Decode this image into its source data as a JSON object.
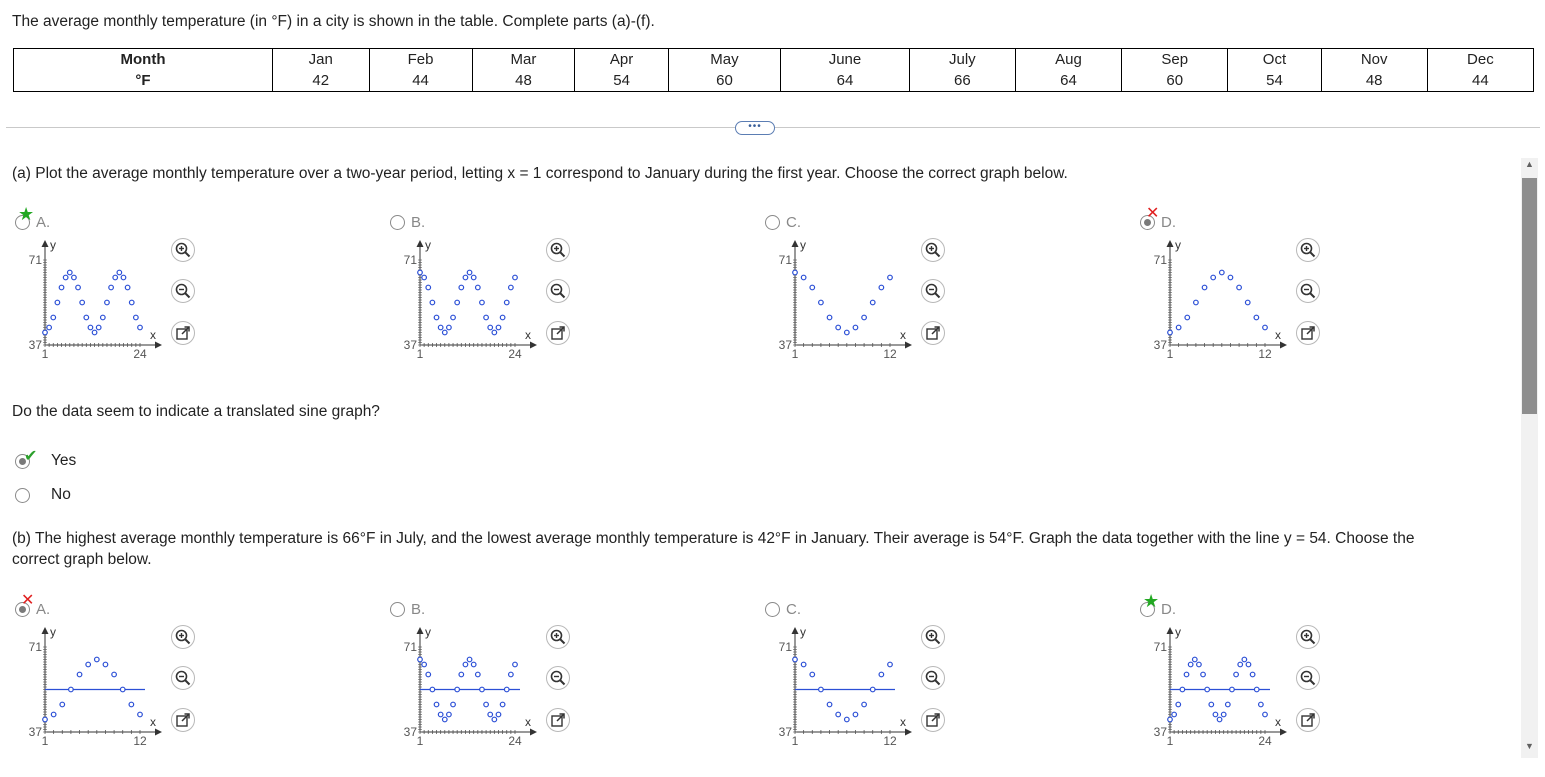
{
  "prompt": "The average monthly temperature (in °F) in a city is shown in the table. Complete parts (a)-(f).",
  "table": {
    "header_label": "Month",
    "value_label": "°F",
    "months": [
      "Jan",
      "Feb",
      "Mar",
      "Apr",
      "May",
      "June",
      "July",
      "Aug",
      "Sep",
      "Oct",
      "Nov",
      "Dec"
    ],
    "temps": [
      "42",
      "44",
      "48",
      "54",
      "60",
      "64",
      "66",
      "64",
      "60",
      "54",
      "48",
      "44"
    ]
  },
  "expander_label": "•••",
  "part_a": {
    "question": "(a) Plot the average monthly temperature over a two-year period, letting x = 1 correspond to January during the first year. Choose the correct graph below.",
    "sub_question": "Do the data seem to indicate a translated sine graph?",
    "yes_label": "Yes",
    "no_label": "No",
    "selected": "Yes",
    "options": [
      {
        "letter": "A.",
        "status": "correct",
        "selected": false
      },
      {
        "letter": "B.",
        "status": "none",
        "selected": false
      },
      {
        "letter": "C.",
        "status": "none",
        "selected": false
      },
      {
        "letter": "D.",
        "status": "incorrect",
        "selected": true
      }
    ]
  },
  "part_b": {
    "question_line1": "(b) The highest average monthly temperature is 66°F in July, and the lowest average monthly temperature is 42°F in January. Their average is 54°F. Graph the data together with the line y = 54. Choose the",
    "question_line2": "correct graph below.",
    "options": [
      {
        "letter": "A.",
        "status": "incorrect",
        "selected": true
      },
      {
        "letter": "B.",
        "status": "none",
        "selected": false
      },
      {
        "letter": "C.",
        "status": "none",
        "selected": false
      },
      {
        "letter": "D.",
        "status": "correct",
        "selected": false
      }
    ]
  },
  "graph_labels": {
    "y_axis": "y",
    "x_axis": "x",
    "y_top": "71",
    "y_bottom": "37",
    "x_start": "1",
    "x_end_12": "12",
    "x_end_24": "24"
  },
  "chart_data": [
    {
      "type": "scatter",
      "id": "a-A",
      "x": [
        1,
        2,
        3,
        4,
        5,
        6,
        7,
        8,
        9,
        10,
        11,
        12,
        13,
        14,
        15,
        16,
        17,
        18,
        19,
        20,
        21,
        22,
        23,
        24
      ],
      "y": [
        42,
        44,
        48,
        54,
        60,
        64,
        66,
        64,
        60,
        54,
        48,
        44,
        42,
        44,
        48,
        54,
        60,
        64,
        66,
        64,
        60,
        54,
        48,
        44
      ],
      "xlim": [
        1,
        24
      ],
      "ylim": [
        37,
        71
      ],
      "hline": null
    },
    {
      "type": "scatter",
      "id": "a-B",
      "x": [
        1,
        2,
        3,
        4,
        5,
        6,
        7,
        8,
        9,
        10,
        11,
        12,
        13,
        14,
        15,
        16,
        17,
        18,
        19,
        20,
        21,
        22,
        23,
        24
      ],
      "y": [
        66,
        64,
        60,
        54,
        48,
        44,
        42,
        44,
        48,
        54,
        60,
        64,
        66,
        64,
        60,
        54,
        48,
        44,
        42,
        44,
        48,
        54,
        60,
        64
      ],
      "xlim": [
        1,
        24
      ],
      "ylim": [
        37,
        71
      ],
      "hline": null
    },
    {
      "type": "scatter",
      "id": "a-C",
      "x": [
        1,
        2,
        3,
        4,
        5,
        6,
        7,
        8,
        9,
        10,
        11,
        12
      ],
      "y": [
        66,
        64,
        60,
        54,
        48,
        44,
        42,
        44,
        48,
        54,
        60,
        64
      ],
      "xlim": [
        1,
        12
      ],
      "ylim": [
        37,
        71
      ],
      "hline": null
    },
    {
      "type": "scatter",
      "id": "a-D",
      "x": [
        1,
        2,
        3,
        4,
        5,
        6,
        7,
        8,
        9,
        10,
        11,
        12
      ],
      "y": [
        42,
        44,
        48,
        54,
        60,
        64,
        66,
        64,
        60,
        54,
        48,
        44
      ],
      "xlim": [
        1,
        12
      ],
      "ylim": [
        37,
        71
      ],
      "hline": null
    },
    {
      "type": "scatter",
      "id": "b-A",
      "x": [
        1,
        2,
        3,
        4,
        5,
        6,
        7,
        8,
        9,
        10,
        11,
        12
      ],
      "y": [
        42,
        44,
        48,
        54,
        60,
        64,
        66,
        64,
        60,
        54,
        48,
        44
      ],
      "xlim": [
        1,
        12
      ],
      "ylim": [
        37,
        71
      ],
      "hline": 54
    },
    {
      "type": "scatter",
      "id": "b-B",
      "x": [
        1,
        2,
        3,
        4,
        5,
        6,
        7,
        8,
        9,
        10,
        11,
        12,
        13,
        14,
        15,
        16,
        17,
        18,
        19,
        20,
        21,
        22,
        23,
        24
      ],
      "y": [
        66,
        64,
        60,
        54,
        48,
        44,
        42,
        44,
        48,
        54,
        60,
        64,
        66,
        64,
        60,
        54,
        48,
        44,
        42,
        44,
        48,
        54,
        60,
        64
      ],
      "xlim": [
        1,
        24
      ],
      "ylim": [
        37,
        71
      ],
      "hline": 54
    },
    {
      "type": "scatter",
      "id": "b-C",
      "x": [
        1,
        2,
        3,
        4,
        5,
        6,
        7,
        8,
        9,
        10,
        11,
        12
      ],
      "y": [
        66,
        64,
        60,
        54,
        48,
        44,
        42,
        44,
        48,
        54,
        60,
        64
      ],
      "xlim": [
        1,
        12
      ],
      "ylim": [
        37,
        71
      ],
      "hline": 54
    },
    {
      "type": "scatter",
      "id": "b-D",
      "x": [
        1,
        2,
        3,
        4,
        5,
        6,
        7,
        8,
        9,
        10,
        11,
        12,
        13,
        14,
        15,
        16,
        17,
        18,
        19,
        20,
        21,
        22,
        23,
        24
      ],
      "y": [
        42,
        44,
        48,
        54,
        60,
        64,
        66,
        64,
        60,
        54,
        48,
        44,
        42,
        44,
        48,
        54,
        60,
        64,
        66,
        64,
        60,
        54,
        48,
        44
      ],
      "xlim": [
        1,
        24
      ],
      "ylim": [
        37,
        71
      ],
      "hline": 54
    }
  ],
  "colors": {
    "point": "#2b4fd6",
    "hline": "#2b4fd6",
    "correct": "#22a822",
    "incorrect": "#e02020"
  },
  "icons": [
    "zoom-in-icon",
    "zoom-out-icon",
    "open-external-icon"
  ]
}
